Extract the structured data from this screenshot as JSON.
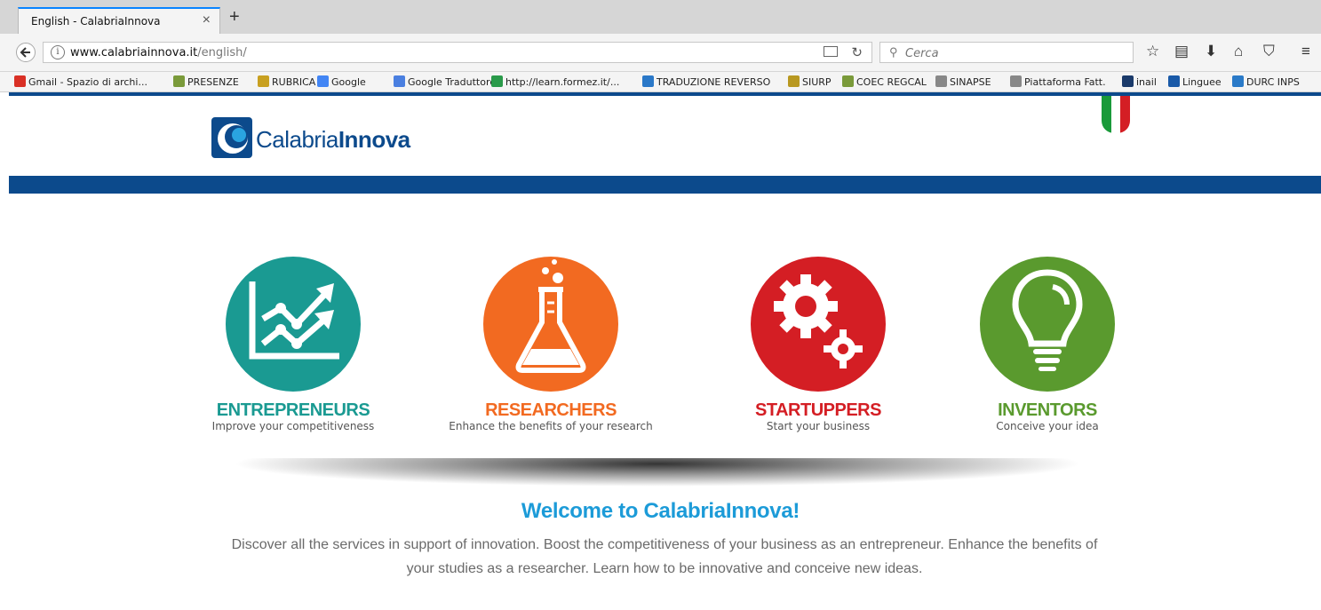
{
  "browser": {
    "tab_title": "English - CalabriaInnova",
    "tab_close": "×",
    "new_tab": "+",
    "url_host": "www.calabriainnova.it",
    "url_path": "/english/",
    "search_placeholder": "Cerca"
  },
  "bookmarks": [
    {
      "label": "Gmail - Spazio di archi...",
      "icon": "gmail-icon",
      "color": "#d93025"
    },
    {
      "label": "PRESENZE",
      "icon": "presenze-icon",
      "color": "#7a9a3a"
    },
    {
      "label": "RUBRICA",
      "icon": "rubrica-icon",
      "color": "#c8a020"
    },
    {
      "label": "Google",
      "icon": "google-icon",
      "color": "#4285f4"
    },
    {
      "label": "Google Traduttore",
      "icon": "translate-icon",
      "color": "#4a7fe0"
    },
    {
      "label": "http://learn.formez.it/...",
      "icon": "formez-icon",
      "color": "#2a9a4a"
    },
    {
      "label": "TRADUZIONE REVERSO",
      "icon": "reverso-icon",
      "color": "#2a78c8"
    },
    {
      "label": "SIURP",
      "icon": "siurp-icon",
      "color": "#b89820"
    },
    {
      "label": "COEC REGCAL",
      "icon": "coec-icon",
      "color": "#7a9a3a"
    },
    {
      "label": "SINAPSE",
      "icon": "globe-icon",
      "color": "#888888"
    },
    {
      "label": "Piattaforma Fatt.",
      "icon": "globe-icon",
      "color": "#888888"
    },
    {
      "label": "inail",
      "icon": "inail-icon",
      "color": "#1a3a6a"
    },
    {
      "label": "Linguee",
      "icon": "linguee-icon",
      "color": "#1a5aa8"
    },
    {
      "label": "DURC INPS",
      "icon": "inps-icon",
      "color": "#2a7ac8"
    }
  ],
  "logo": {
    "prefix": "Calabria",
    "suffix": "Innova"
  },
  "categories": [
    {
      "title": "ENTREPRENEURS",
      "subtitle": "Improve your competitiveness",
      "color": "#1a9a92",
      "icon": "growth-chart-icon"
    },
    {
      "title": "RESEARCHERS",
      "subtitle": "Enhance the benefits of your research",
      "color": "#f26a21",
      "icon": "flask-icon"
    },
    {
      "title": "STARTUPPERS",
      "subtitle": "Start your business",
      "color": "#d41e24",
      "icon": "gears-icon"
    },
    {
      "title": "INVENTORS",
      "subtitle": "Conceive your idea",
      "color": "#5a9a2e",
      "icon": "lightbulb-icon"
    }
  ],
  "welcome": {
    "title": "Welcome to CalabriaInnova!",
    "text": "Discover all the services in support of innovation. Boost the competitiveness of your business as an entrepreneur. Enhance the benefits of your studies as a researcher. Learn how to be innovative and conceive new ideas."
  },
  "colors": {
    "brand_blue": "#0c4a8c",
    "welcome_blue": "#1c9bd8"
  }
}
